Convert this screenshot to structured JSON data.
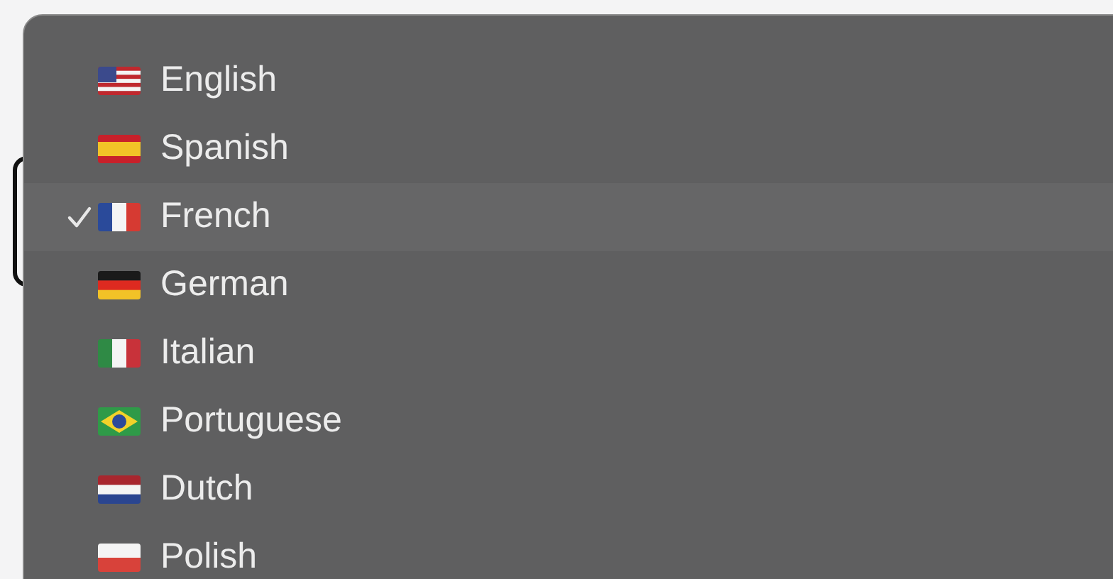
{
  "menu": {
    "items": [
      {
        "label": "English",
        "selected": false
      },
      {
        "label": "Spanish",
        "selected": false
      },
      {
        "label": "French",
        "selected": true
      },
      {
        "label": "German",
        "selected": false
      },
      {
        "label": "Italian",
        "selected": false
      },
      {
        "label": "Portuguese",
        "selected": false
      },
      {
        "label": "Dutch",
        "selected": false
      },
      {
        "label": "Polish",
        "selected": false
      }
    ]
  }
}
